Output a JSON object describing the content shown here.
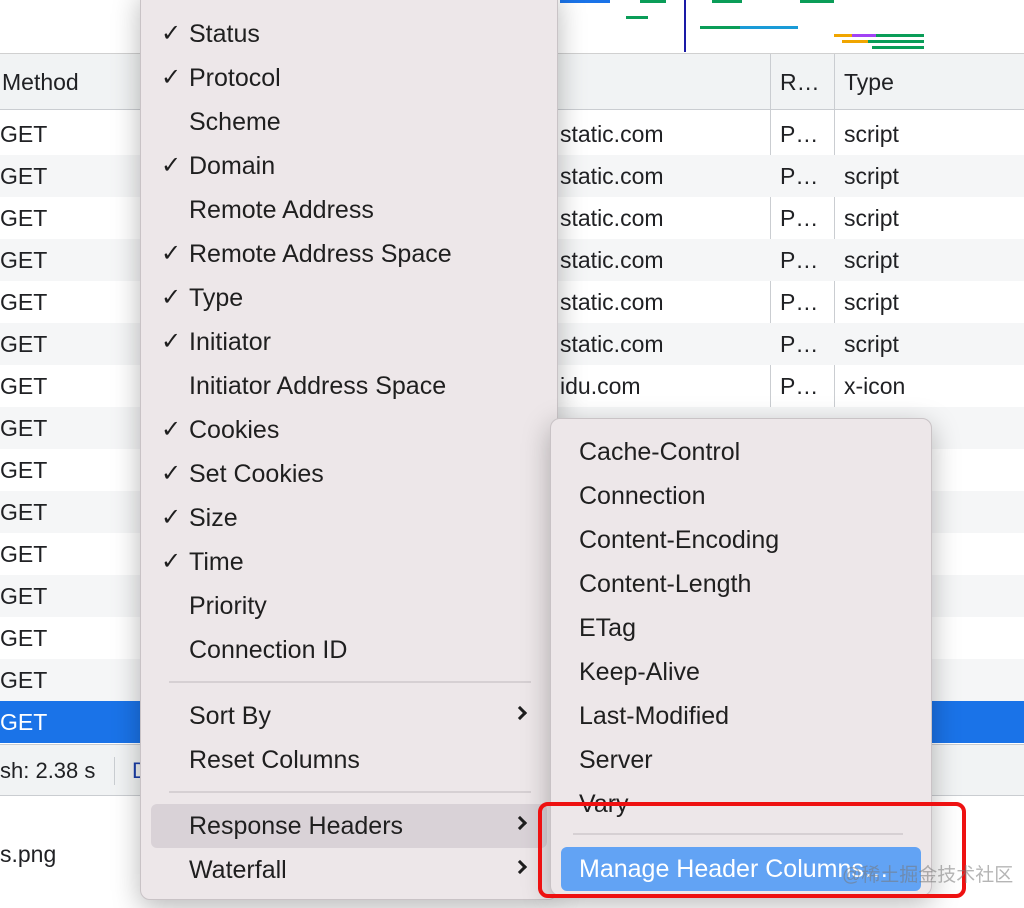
{
  "table": {
    "headers": {
      "method": "Method",
      "remote": "R…",
      "type": "Type"
    },
    "rows": [
      {
        "method": "GET",
        "domain": "static.com",
        "remote": "P…",
        "type": "script"
      },
      {
        "method": "GET",
        "domain": "static.com",
        "remote": "P…",
        "type": "script"
      },
      {
        "method": "GET",
        "domain": "static.com",
        "remote": "P…",
        "type": "script"
      },
      {
        "method": "GET",
        "domain": "static.com",
        "remote": "P…",
        "type": "script"
      },
      {
        "method": "GET",
        "domain": "static.com",
        "remote": "P…",
        "type": "script"
      },
      {
        "method": "GET",
        "domain": "static.com",
        "remote": "P…",
        "type": "script"
      },
      {
        "method": "GET",
        "domain": "idu.com",
        "remote": "P…",
        "type": "x-icon"
      },
      {
        "method": "GET"
      },
      {
        "method": "GET"
      },
      {
        "method": "GET"
      },
      {
        "method": "GET"
      },
      {
        "method": "GET"
      },
      {
        "method": "GET"
      },
      {
        "method": "GET"
      },
      {
        "method": "GET"
      }
    ]
  },
  "status_bar": {
    "finish": "sh: 2.38 s",
    "dom": "D"
  },
  "bottom_pane": {
    "file": "s.png"
  },
  "context_menu": {
    "columns": [
      {
        "label": "Status",
        "checked": true
      },
      {
        "label": "Protocol",
        "checked": true
      },
      {
        "label": "Scheme",
        "checked": false
      },
      {
        "label": "Domain",
        "checked": true
      },
      {
        "label": "Remote Address",
        "checked": false
      },
      {
        "label": "Remote Address Space",
        "checked": true
      },
      {
        "label": "Type",
        "checked": true
      },
      {
        "label": "Initiator",
        "checked": true
      },
      {
        "label": "Initiator Address Space",
        "checked": false
      },
      {
        "label": "Cookies",
        "checked": true
      },
      {
        "label": "Set Cookies",
        "checked": true
      },
      {
        "label": "Size",
        "checked": true
      },
      {
        "label": "Time",
        "checked": true
      },
      {
        "label": "Priority",
        "checked": false
      },
      {
        "label": "Connection ID",
        "checked": false
      }
    ],
    "check_mark": "✓",
    "sort_by": "Sort By",
    "reset_columns": "Reset Columns",
    "response_headers": "Response Headers",
    "waterfall": "Waterfall"
  },
  "submenu": {
    "items": [
      "Cache-Control",
      "Connection",
      "Content-Encoding",
      "Content-Length",
      "ETag",
      "Keep-Alive",
      "Last-Modified",
      "Server",
      "Vary"
    ],
    "manage": "Manage Header Columns…"
  },
  "watermark": "@稀土掘金技术社区",
  "colors": {
    "selected_row": "#1a73e8",
    "menu_bg": "#ede7e9",
    "menu_highlight": "#62a3f4",
    "annotation_box": "#ee1111"
  },
  "icons": {
    "check": "check-icon",
    "submenu_arrow": "chevron-right-icon"
  }
}
